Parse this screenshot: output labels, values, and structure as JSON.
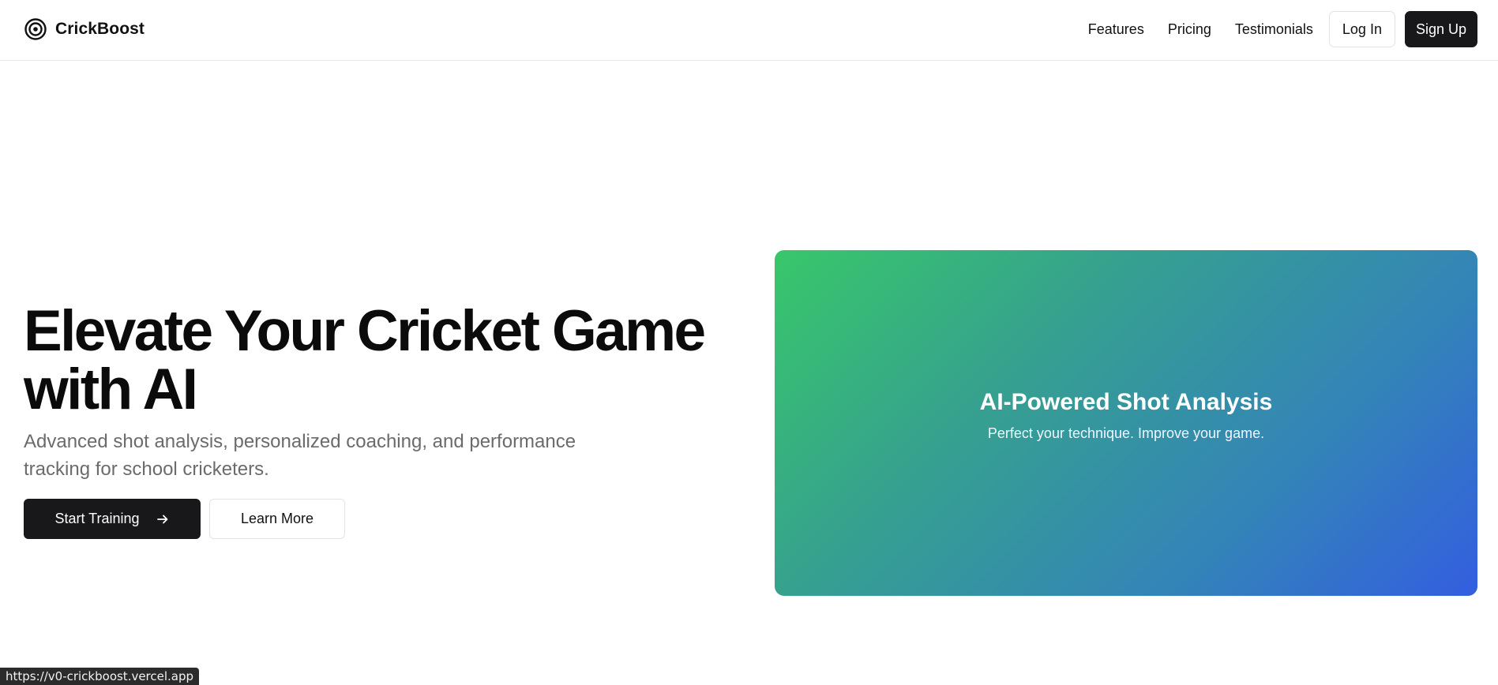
{
  "brand": {
    "name": "CrickBoost",
    "icon": "target-icon"
  },
  "nav": {
    "links": [
      "Features",
      "Pricing",
      "Testimonials"
    ],
    "login_label": "Log In",
    "signup_label": "Sign Up"
  },
  "hero": {
    "title_line1": "Elevate Your Cricket Game",
    "title_line2": "with AI",
    "subtitle": "Advanced shot analysis, personalized coaching, and performance tracking for school cricketers.",
    "primary_cta": "Start Training",
    "primary_cta_icon": "arrow-right-icon",
    "secondary_cta": "Learn More"
  },
  "feature_card": {
    "title": "AI-Powered Shot Analysis",
    "subtitle": "Perfect your technique. Improve your game.",
    "gradient": [
      "#38c76a",
      "#335ee0"
    ]
  },
  "status_bar": {
    "url": "https://v0-crickboost.vercel.app"
  },
  "colors": {
    "primary_button": "#18181b",
    "text": "#111111",
    "muted_text": "#6b6b6b"
  }
}
